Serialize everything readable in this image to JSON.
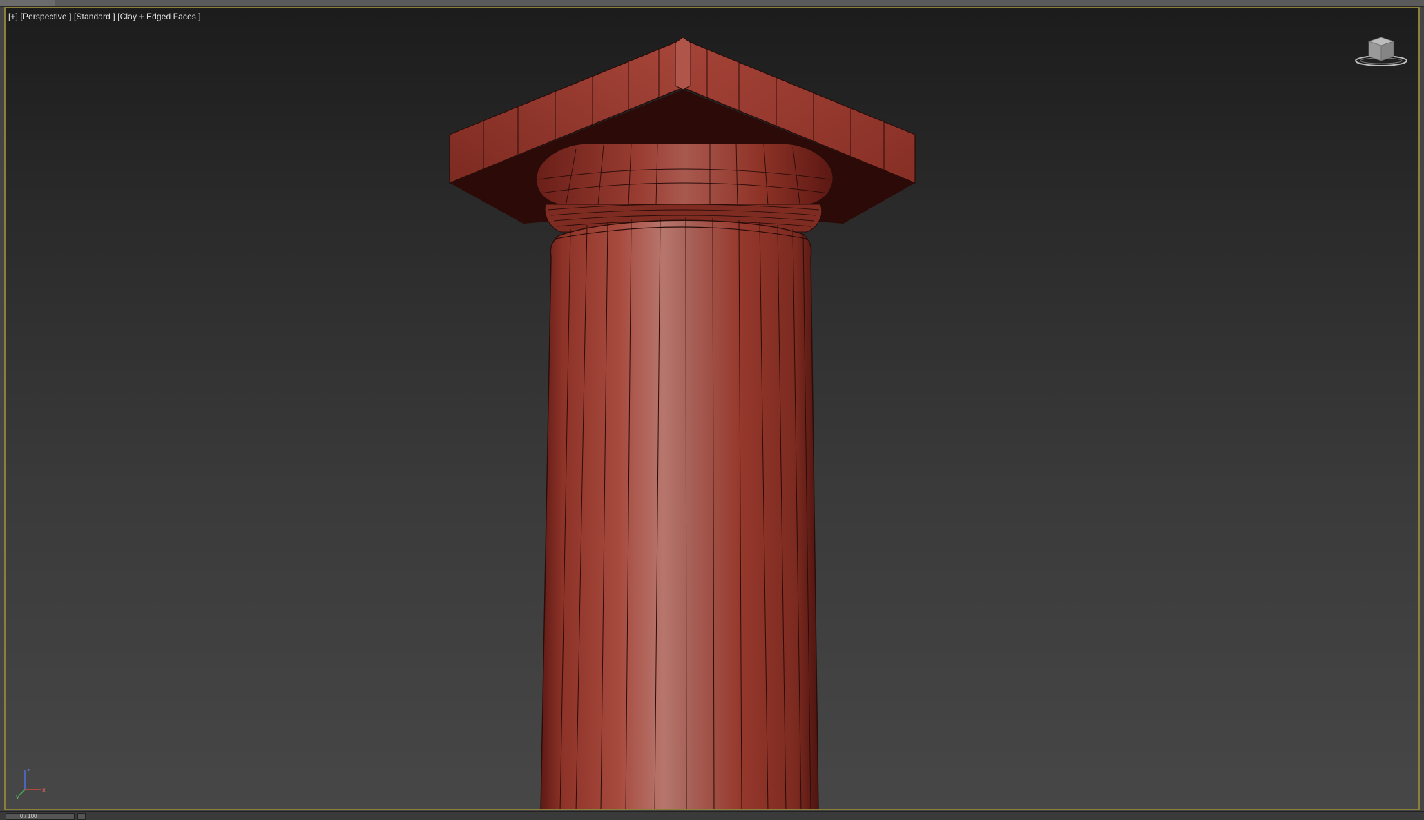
{
  "viewport": {
    "label_plus": "[+]",
    "label_view": "[Perspective ]",
    "label_shading": "[Standard ]",
    "label_style": "[Clay + Edged Faces ]"
  },
  "scene": {
    "object": "doric-column",
    "object_color": "#9c3a30",
    "edge_color": "#2a0c09",
    "viewcube_icon": "viewcube-icon",
    "axis_icon": "axis-tripod-icon",
    "axis_labels": {
      "x": "x",
      "y": "y",
      "z": "z"
    }
  },
  "status": {
    "frame_value": "0 / 100"
  }
}
